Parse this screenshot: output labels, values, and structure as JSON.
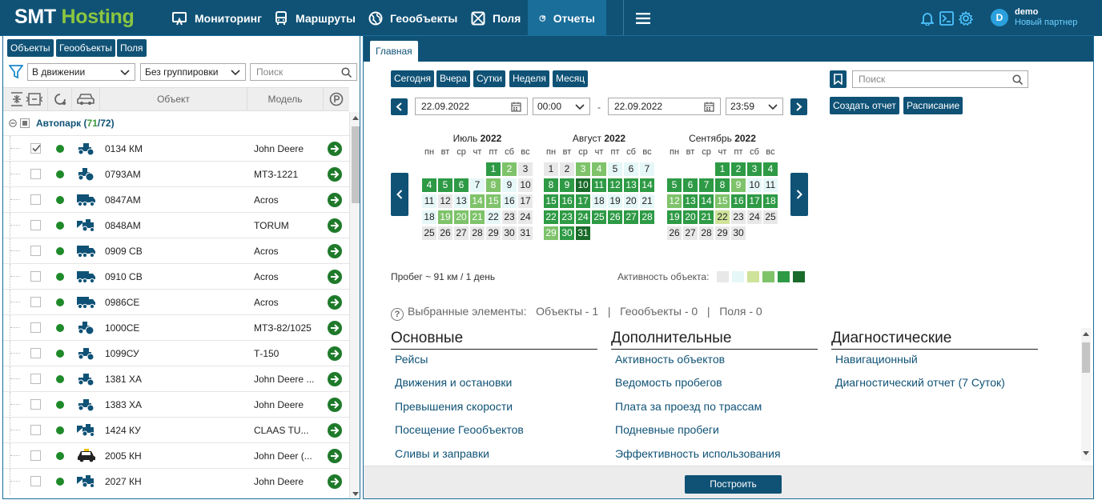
{
  "header": {
    "logo_part1": "SMT",
    "logo_part2": "Hosting",
    "nav": [
      {
        "label": "Мониторинг",
        "icon": "monitor-icon"
      },
      {
        "label": "Маршруты",
        "icon": "bus-icon"
      },
      {
        "label": "Геообъекты",
        "icon": "globe-icon"
      },
      {
        "label": "Поля",
        "icon": "field-icon"
      },
      {
        "label": "Отчеты",
        "icon": "reports-icon",
        "active": true
      }
    ],
    "user": {
      "initial": "D",
      "name": "demo",
      "partner": "Новый партнер"
    }
  },
  "left": {
    "tabs": [
      "Объекты",
      "Геообъекты",
      "Поля"
    ],
    "filter_state": "В движении",
    "filter_group": "Без группировки",
    "search_placeholder": "Поиск",
    "columns": {
      "object": "Объект",
      "model": "Модель"
    },
    "group": {
      "name": "Автопарк",
      "online": "71",
      "total": "72"
    },
    "rows": [
      {
        "name": "0134 КМ",
        "model": "John Deere",
        "vehicle": "tractor",
        "checked": true
      },
      {
        "name": "0793АМ",
        "model": "МТЗ-1221",
        "vehicle": "small-tractor"
      },
      {
        "name": "0847АМ",
        "model": "Acros",
        "vehicle": "truck"
      },
      {
        "name": "0848АМ",
        "model": "TORUM",
        "vehicle": "harvester"
      },
      {
        "name": "0909 СВ",
        "model": "Acros",
        "vehicle": "truck"
      },
      {
        "name": "0910 СВ",
        "model": "Acros",
        "vehicle": "truck"
      },
      {
        "name": "0986СЕ",
        "model": "Acros",
        "vehicle": "truck"
      },
      {
        "name": "1000СЕ",
        "model": "МТЗ-82/1025",
        "vehicle": "small-tractor"
      },
      {
        "name": "1099СУ",
        "model": "Т-150",
        "vehicle": "tractor"
      },
      {
        "name": "1381 ХА",
        "model": "John Deere ...",
        "vehicle": "tractor"
      },
      {
        "name": "1383 ХА",
        "model": "John Deere",
        "vehicle": "tractor"
      },
      {
        "name": "1424 КУ",
        "model": "CLAAS TU...",
        "vehicle": "harvester"
      },
      {
        "name": "2005 КН",
        "model": "John Deer (...",
        "vehicle": "car"
      },
      {
        "name": "2027 КН",
        "model": "John Deere",
        "vehicle": "harvester"
      }
    ]
  },
  "right": {
    "tab": "Главная",
    "quick": [
      "Сегодня",
      "Вчера",
      "Сутки",
      "Неделя",
      "Месяц"
    ],
    "date_from": "22.09.2022",
    "time_from": "00:00",
    "date_to": "22.09.2022",
    "time_to": "23:59",
    "dash": "-",
    "search_placeholder": "Поиск",
    "create_report": "Создать отчет",
    "schedule": "Расписание",
    "weekdays": [
      "пн",
      "вт",
      "ср",
      "чт",
      "пт",
      "сб",
      "вс"
    ],
    "activity_palette": [
      "#e8e8e8",
      "#e6f7f7",
      "#cfe39a",
      "#7ec36a",
      "#2e9a45",
      "#1a6b2a"
    ],
    "months": [
      {
        "name": "Июль",
        "year": "2022",
        "offset": 4,
        "days": 31,
        "levels": [
          4,
          3,
          0,
          4,
          4,
          4,
          1,
          3,
          1,
          0,
          1,
          0,
          1,
          3,
          3,
          1,
          0,
          1,
          3,
          3,
          3,
          1,
          0,
          0,
          0,
          0,
          0,
          0,
          0,
          0,
          0
        ]
      },
      {
        "name": "Август",
        "year": "2022",
        "offset": 0,
        "days": 31,
        "levels": [
          0,
          0,
          3,
          3,
          1,
          1,
          1,
          4,
          4,
          5,
          4,
          4,
          4,
          4,
          4,
          4,
          4,
          1,
          1,
          1,
          1,
          4,
          4,
          4,
          4,
          4,
          4,
          4,
          3,
          4,
          5
        ]
      },
      {
        "name": "Сентябрь",
        "year": "2022",
        "offset": 3,
        "days": 30,
        "levels": [
          4,
          4,
          4,
          4,
          4,
          4,
          4,
          4,
          3,
          1,
          1,
          3,
          4,
          4,
          3,
          4,
          4,
          4,
          4,
          4,
          4,
          2,
          0,
          0,
          0,
          0,
          0,
          0,
          0,
          0
        ]
      }
    ],
    "mileage": "Пробег ~ 91 км / 1 день",
    "activity_label": "Активность объекта:",
    "selected": {
      "label": "Выбранные элементы:",
      "objects": "Объекты - 1",
      "sep": "|",
      "geo": "Геообъекты - 0",
      "fields": "Поля - 0"
    },
    "columns": [
      {
        "title": "Основные",
        "links": [
          "Рейсы",
          "Движения и остановки",
          "Превышения скорости",
          "Посещение Геообъектов",
          "Сливы и заправки"
        ]
      },
      {
        "title": "Дополнительные",
        "links": [
          "Активность объектов",
          "Ведомость пробегов",
          "Плата за проезд по трассам",
          "Подневные пробеги",
          "Эффективность использования"
        ]
      },
      {
        "title": "Диагностические",
        "links": [
          "Навигационный",
          "Диагностический отчет (7 Суток)"
        ]
      }
    ],
    "build_button": "Построить"
  }
}
